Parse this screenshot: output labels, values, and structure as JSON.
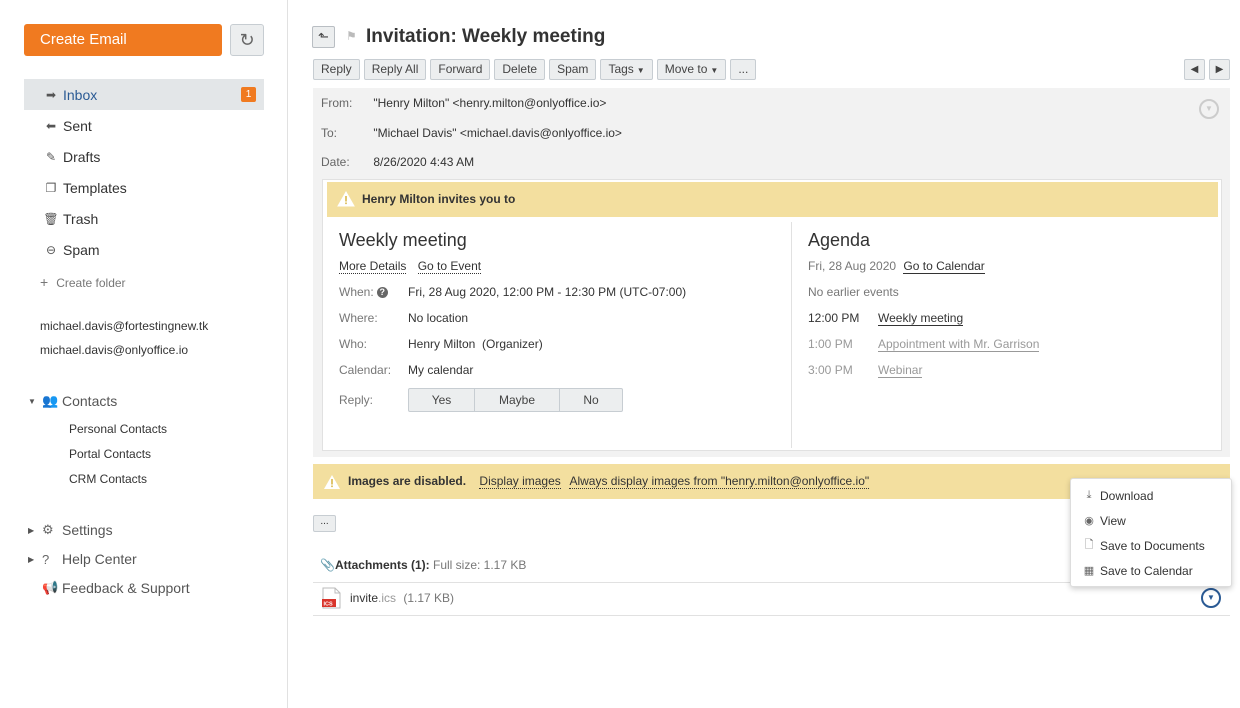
{
  "sidebar": {
    "create_label": "Create Email",
    "refresh_icon": "refresh-icon",
    "folders": [
      {
        "label": "Inbox",
        "icon": "arrow-right-icon",
        "badge": "1",
        "active": true
      },
      {
        "label": "Sent",
        "icon": "reply-icon"
      },
      {
        "label": "Drafts",
        "icon": "edit-icon"
      },
      {
        "label": "Templates",
        "icon": "templates-icon"
      },
      {
        "label": "Trash",
        "icon": "trash-icon"
      },
      {
        "label": "Spam",
        "icon": "spam-icon"
      }
    ],
    "create_folder": "Create folder",
    "accounts": [
      "michael.davis@fortestingnew.tk",
      "michael.davis@onlyoffice.io"
    ],
    "contacts": {
      "label": "Contacts",
      "items": [
        "Personal Contacts",
        "Portal Contacts",
        "CRM Contacts"
      ]
    },
    "settings": "Settings",
    "help": "Help Center",
    "feedback": "Feedback & Support"
  },
  "message": {
    "subject": "Invitation: Weekly meeting",
    "toolbar": {
      "reply": "Reply",
      "reply_all": "Reply All",
      "forward": "Forward",
      "delete": "Delete",
      "spam": "Spam",
      "tags": "Tags",
      "move_to": "Move to",
      "more": "..."
    },
    "from_label": "From:",
    "from": "\"Henry Milton\" <henry.milton@onlyoffice.io>",
    "to_label": "To:",
    "to": "\"Michael Davis\" <michael.davis@onlyoffice.io>",
    "date_label": "Date:",
    "date": "8/26/2020 4:43 AM"
  },
  "invite": {
    "banner": "Henry Milton invites you to",
    "title": "Weekly meeting",
    "more_details": "More Details",
    "go_to_event": "Go to Event",
    "when_label": "When:",
    "when": "Fri, 28 Aug 2020, 12:00 PM - 12:30 PM (UTC-07:00)",
    "where_label": "Where:",
    "where": "No location",
    "who_label": "Who:",
    "who": "Henry Milton  (Organizer)",
    "calendar_label": "Calendar:",
    "calendar": "My calendar",
    "reply_label": "Reply:",
    "reply_yes": "Yes",
    "reply_maybe": "Maybe",
    "reply_no": "No"
  },
  "agenda": {
    "title": "Agenda",
    "date": "Fri, 28 Aug 2020",
    "go_to_calendar": "Go to Calendar",
    "no_earlier": "No earlier events",
    "events": [
      {
        "time": "12:00 PM",
        "title": "Weekly meeting",
        "current": true
      },
      {
        "time": "1:00 PM",
        "title": "Appointment with Mr. Garrison",
        "current": false
      },
      {
        "time": "3:00 PM",
        "title": "Webinar",
        "current": false
      }
    ]
  },
  "images_banner": {
    "text": "Images are disabled.",
    "display": "Display images",
    "always": "Always display images from \"henry.milton@onlyoffice.io\""
  },
  "attachments": {
    "more": "...",
    "title": "Attachments (1):",
    "full_size": "Full size: 1.17 KB",
    "file_base": "invite",
    "file_ext": ".ics",
    "file_size": "(1.17 KB)",
    "file_badge": "ICS"
  },
  "context_menu": [
    {
      "label": "Download",
      "icon": "download-icon"
    },
    {
      "label": "View",
      "icon": "eye-icon"
    },
    {
      "label": "Save to Documents",
      "icon": "document-icon"
    },
    {
      "label": "Save to Calendar",
      "icon": "calendar-icon"
    }
  ],
  "colors": {
    "accent": "#f07a20",
    "banner": "#f3df9f",
    "link_blue": "#2a5a94"
  }
}
